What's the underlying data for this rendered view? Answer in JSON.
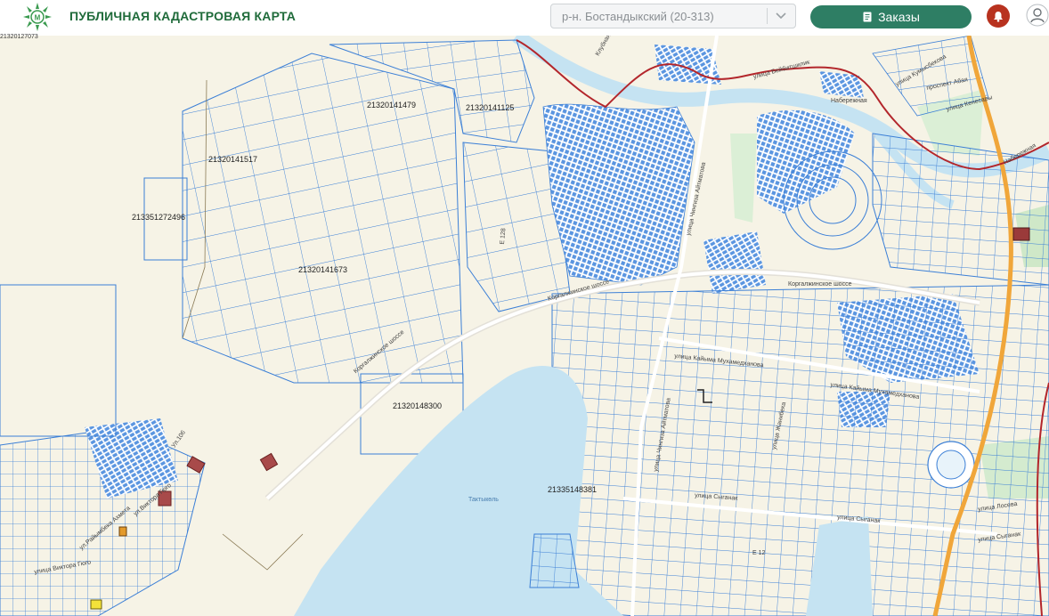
{
  "header": {
    "title": "ПУБЛИЧНАЯ КАДАСТРОВАЯ КАРТА",
    "district_value": "р-н. Бостандыкский (20-313)",
    "orders_label": "Заказы",
    "logo_icon": "emblem-logo-icon",
    "bell_icon": "bell-icon",
    "user_icon": "user-icon"
  },
  "colors": {
    "brand_green": "#1f6b3a",
    "orders_button": "#2e7e64",
    "bell_button": "#b8321f",
    "parcel_line": "#3b7fd6",
    "dense_parcel_fill": "#5a95e0",
    "water": "#c5e3f2",
    "district_border": "#b3262b",
    "main_road": "#f0a63a",
    "ground": "#f6f3e6"
  },
  "map": {
    "corner_number": "21320127073",
    "parcel_labels": [
      "21320141479",
      "21320141125",
      "21320141517",
      "213351272496",
      "21320141673",
      "21320148300",
      "21335148381"
    ],
    "street_labels": [
      "улица Кумысбекова",
      "проспект Абая",
      "улица Кенесары",
      "Набережная",
      "Набережная",
      "улица Бейбитшилик",
      "Клубная",
      "улица Чингиза Айтматова",
      "Коргалжинское шоссе",
      "Коргалжинское шоссе",
      "улица Кайыма Мухамедханова",
      "улица Кайыма Мухамедханова",
      "улица Чингиза Айтматова",
      "улица Сыганак",
      "улица Сыганак",
      "улица Сыганак",
      "улица Лосева",
      "улица Жанибека",
      "Е 12",
      "Е 128",
      "Ул.106",
      "ул.Виктора Гюго",
      "ул.Райымбека Ахмета",
      "улица Виктора Гюго",
      "Коргалжинское шоссе"
    ],
    "water_name": "Тактыкөль"
  }
}
